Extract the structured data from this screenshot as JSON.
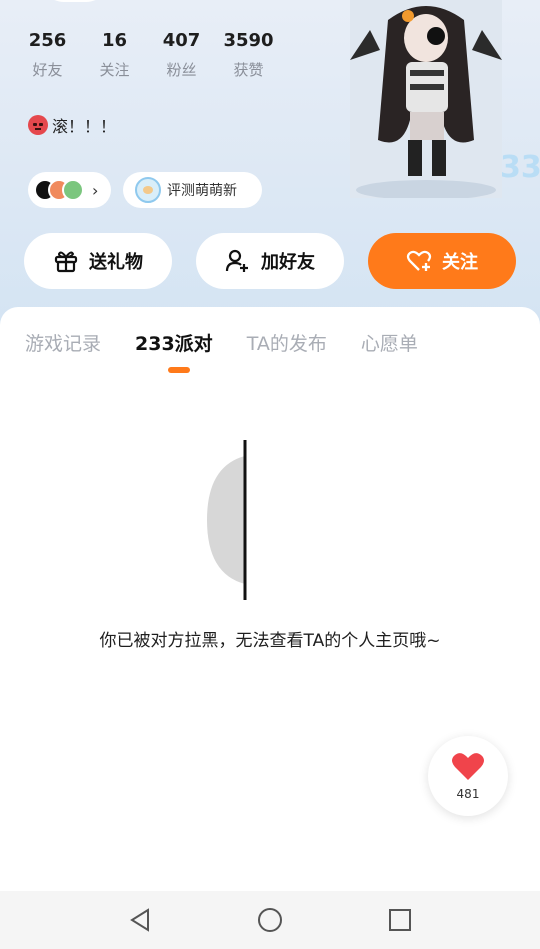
{
  "profile": {
    "stats": [
      {
        "value": "256",
        "label": "好友"
      },
      {
        "value": "16",
        "label": "关注"
      },
      {
        "value": "407",
        "label": "粉丝"
      },
      {
        "value": "3590",
        "label": "获赞"
      }
    ],
    "bio": "滚！！！",
    "apps_chevron": "›",
    "tag_label": "评测萌萌新"
  },
  "badge": "33",
  "actions": {
    "gift_label": "送礼物",
    "add_friend_label": "加好友",
    "follow_label": "关注"
  },
  "tabs": [
    {
      "label": "游戏记录",
      "active": false
    },
    {
      "label": "233派对",
      "active": true
    },
    {
      "label": "TA的发布",
      "active": false
    },
    {
      "label": "心愿单",
      "active": false
    }
  ],
  "blocked_message": "你已被对方拉黑，无法查看TA的个人主页哦~",
  "like": {
    "count": "481"
  },
  "colors": {
    "accent": "#ff7a1a",
    "like_heart": "#f0444b",
    "header_bg": "#dde8f4"
  },
  "icons": {
    "gift": "gift-icon",
    "add_friend": "add-user-icon",
    "follow": "heart-plus-icon",
    "like": "heart-icon",
    "nav": [
      "back-triangle-icon",
      "home-circle-icon",
      "recents-square-icon"
    ]
  }
}
